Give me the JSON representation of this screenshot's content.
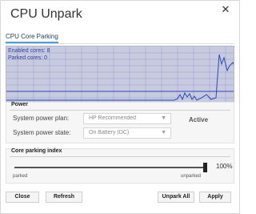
{
  "window": {
    "title": "CPU Unpark",
    "close_glyph": "✕"
  },
  "tab": {
    "label": "CPU Core Parking"
  },
  "graph": {
    "enabled_label": "Enabled cores: 8",
    "parked_label": "Parked cores: 0",
    "grid_color": "#8f9fd0",
    "trace_color": "#2c47b7",
    "background": "#c8cbe0"
  },
  "power": {
    "title": "Power",
    "plan_label": "System power plan:",
    "plan_value": "HP Recommended",
    "state_label": "System power state:",
    "state_value": "On Battery (DC)",
    "status": "Active"
  },
  "core_parking": {
    "title": "Core parking index",
    "value_text": "100%",
    "level": 1.0,
    "min_label": "parked",
    "max_label": "unparked"
  },
  "buttons": {
    "close": "Close",
    "refresh": "Refresh",
    "unpark_all": "Unpark All",
    "apply": "Apply"
  }
}
